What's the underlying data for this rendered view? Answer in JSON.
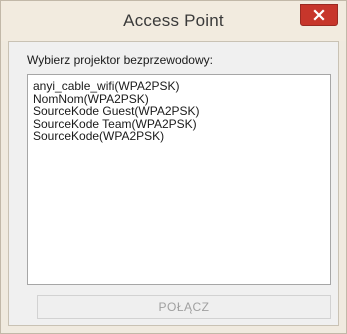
{
  "window": {
    "title": "Access Point"
  },
  "dialog": {
    "prompt": "Wybierz projektor bezprzewodowy:",
    "networks": [
      "anyi_cable_wifi(WPA2PSK)",
      "NomNom(WPA2PSK)",
      "SourceKode Guest(WPA2PSK)",
      "SourceKode Team(WPA2PSK)",
      "SourceKode(WPA2PSK)"
    ],
    "connect_label": "POŁĄCZ",
    "connect_enabled": false
  },
  "icons": {
    "close": "close-icon"
  },
  "colors": {
    "close_button": "#c7362b",
    "window_frame": "#f0eadf",
    "disabled_text": "#a0a0a0"
  }
}
